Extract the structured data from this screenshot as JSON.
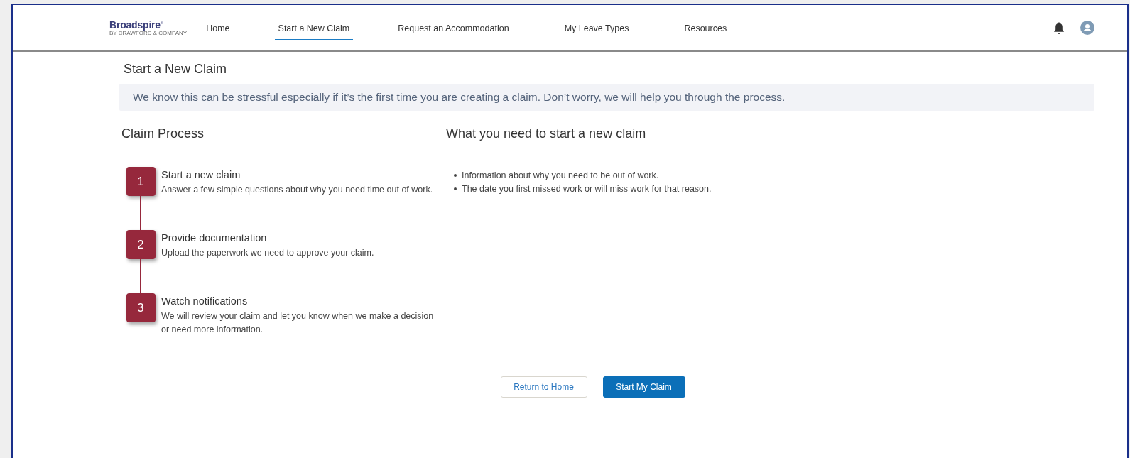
{
  "logo": {
    "name": "Broadspire",
    "mark": "®",
    "tagline": "BY CRAWFORD & COMPANY"
  },
  "nav": [
    {
      "label": "Home",
      "selected": false
    },
    {
      "label": "Start a New Claim",
      "selected": true
    },
    {
      "label": "Request an Accommodation",
      "selected": false
    },
    {
      "label": "My Leave Types",
      "selected": false
    },
    {
      "label": "Resources",
      "selected": false
    }
  ],
  "page_title": "Start a New Claim",
  "banner": "We know this can be stressful especially if it’s the first time you are creating a claim. Don’t worry, we will help you through the process.",
  "process": {
    "heading": "Claim Process",
    "steps": [
      {
        "number": "1",
        "title": "Start a new claim",
        "text": "Answer a few simple questions about why you need time out of work."
      },
      {
        "number": "2",
        "title": "Provide documentation",
        "text": "Upload the paperwork we need to approve your claim."
      },
      {
        "number": "3",
        "title": "Watch notifications",
        "text": "We will review your claim and let you know when we make a decision or need more information."
      }
    ]
  },
  "requirements": {
    "heading": "What you need to start a new claim",
    "items": [
      "Information about why you need to be out of work.",
      "The date you first missed work or will miss work for that reason."
    ]
  },
  "buttons": [
    {
      "label": "Return to Home",
      "kind": "secondary"
    },
    {
      "label": "Start My Claim",
      "kind": "primary"
    }
  ]
}
